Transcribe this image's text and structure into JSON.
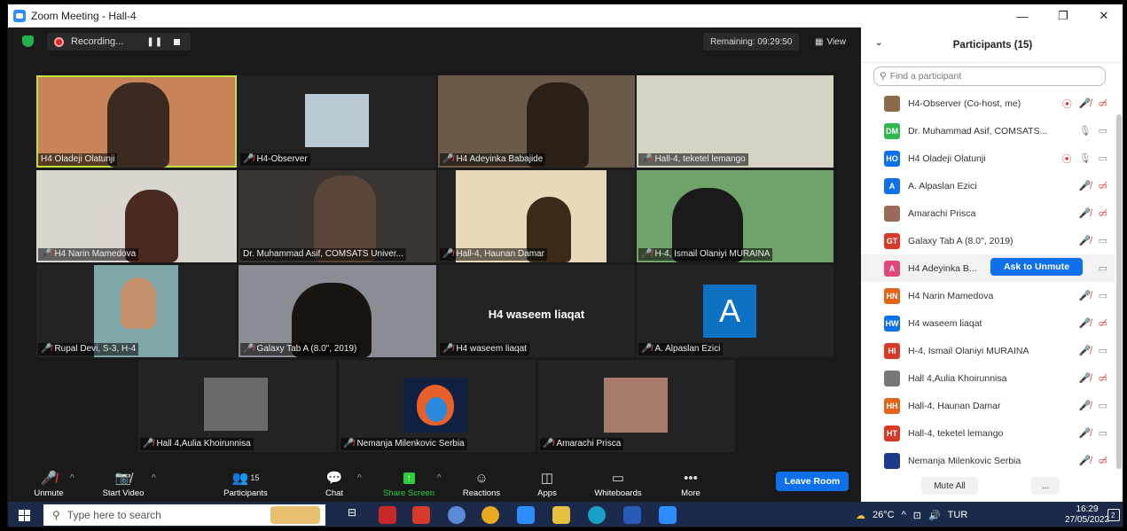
{
  "window": {
    "title": "Zoom Meeting - Hall-4",
    "controls": [
      "—",
      "❐",
      "✕"
    ]
  },
  "top": {
    "recording_label": "Recording...",
    "remaining": "Remaining: 09:29:50",
    "view_label": "View"
  },
  "tiles": [
    {
      "name": "H4 Oladeji Olatunji",
      "muted": false
    },
    {
      "name": "H4-Observer",
      "muted": true
    },
    {
      "name": "H4 Adeyinka Babajide",
      "muted": true
    },
    {
      "name": "Hall-4, teketel lemango",
      "muted": true
    },
    {
      "name": "H4 Narin Mamedova",
      "muted": true
    },
    {
      "name": "Dr. Muhammad Asif, COMSATS Univer...",
      "muted": false
    },
    {
      "name": "Hall-4, Haunan Damar",
      "muted": true
    },
    {
      "name": "H-4, Ismail Olaniyi MURAINA",
      "muted": true
    },
    {
      "name": "Rupal Devi, S-3, H-4",
      "muted": true
    },
    {
      "name": "Galaxy Tab A (8.0\", 2019)",
      "muted": true
    },
    {
      "name": "H4 waseem liaqat",
      "muted": true,
      "center_label": "H4 waseem liaqat"
    },
    {
      "name": "A. Alpaslan Ezici",
      "muted": true,
      "avatar_letter": "A"
    },
    {
      "name": "Hall 4,Aulia Khoirunnisa",
      "muted": true
    },
    {
      "name": "Nemanja Milenkovic Serbia",
      "muted": true
    },
    {
      "name": "Amarachi Prisca",
      "muted": true
    }
  ],
  "toolbar": {
    "unmute": "Unmute",
    "start_video": "Start Video",
    "participants": "Participants",
    "participants_count": "15",
    "chat": "Chat",
    "share_screen": "Share Screen",
    "reactions": "Reactions",
    "apps": "Apps",
    "whiteboards": "Whiteboards",
    "more": "More",
    "leave": "Leave Room"
  },
  "panel": {
    "title": "Participants (15)",
    "search_placeholder": "Find a participant",
    "ask_to_unmute": "Ask to Unmute",
    "mute_all": "Mute All",
    "more": "...",
    "participants": [
      {
        "name": "H4-Observer (Co-host, me)",
        "initials": "",
        "color": "#8a6a4a"
      },
      {
        "name": "Dr. Muhammad Asif, COMSATS...",
        "initials": "DM",
        "color": "#2eb84b"
      },
      {
        "name": "H4 Oladeji Olatunji",
        "initials": "HO",
        "color": "#0e71eb"
      },
      {
        "name": "A. Alpaslan Ezici",
        "initials": "A",
        "color": "#0e71eb"
      },
      {
        "name": "Amarachi Prisca",
        "initials": "",
        "color": "#9a6a5a"
      },
      {
        "name": "Galaxy Tab A (8.0\", 2019)",
        "initials": "GT",
        "color": "#d83a2a"
      },
      {
        "name": "H4 Adeyinka B...",
        "initials": "A",
        "color": "#e0487a"
      },
      {
        "name": "H4 Narin Mamedova",
        "initials": "HN",
        "color": "#e3631a"
      },
      {
        "name": "H4 waseem liaqat",
        "initials": "HW",
        "color": "#0e71eb"
      },
      {
        "name": "H-4, Ismail Olaniyi MURAINA",
        "initials": "HI",
        "color": "#d83a2a"
      },
      {
        "name": "Hall 4,Aulia Khoirunnisa",
        "initials": "",
        "color": "#777"
      },
      {
        "name": "Hall-4, Haunan Damar",
        "initials": "HH",
        "color": "#e3631a"
      },
      {
        "name": "Hall-4, teketel lemango",
        "initials": "HT",
        "color": "#d83a2a"
      },
      {
        "name": "Nemanja Milenkovic Serbia",
        "initials": "",
        "color": "#1e3a8a"
      }
    ]
  },
  "taskbar": {
    "search_placeholder": "Type here to search",
    "temperature": "26°C",
    "language": "TUR",
    "time": "16:29",
    "date": "27/05/2022",
    "notification_count": "2"
  }
}
